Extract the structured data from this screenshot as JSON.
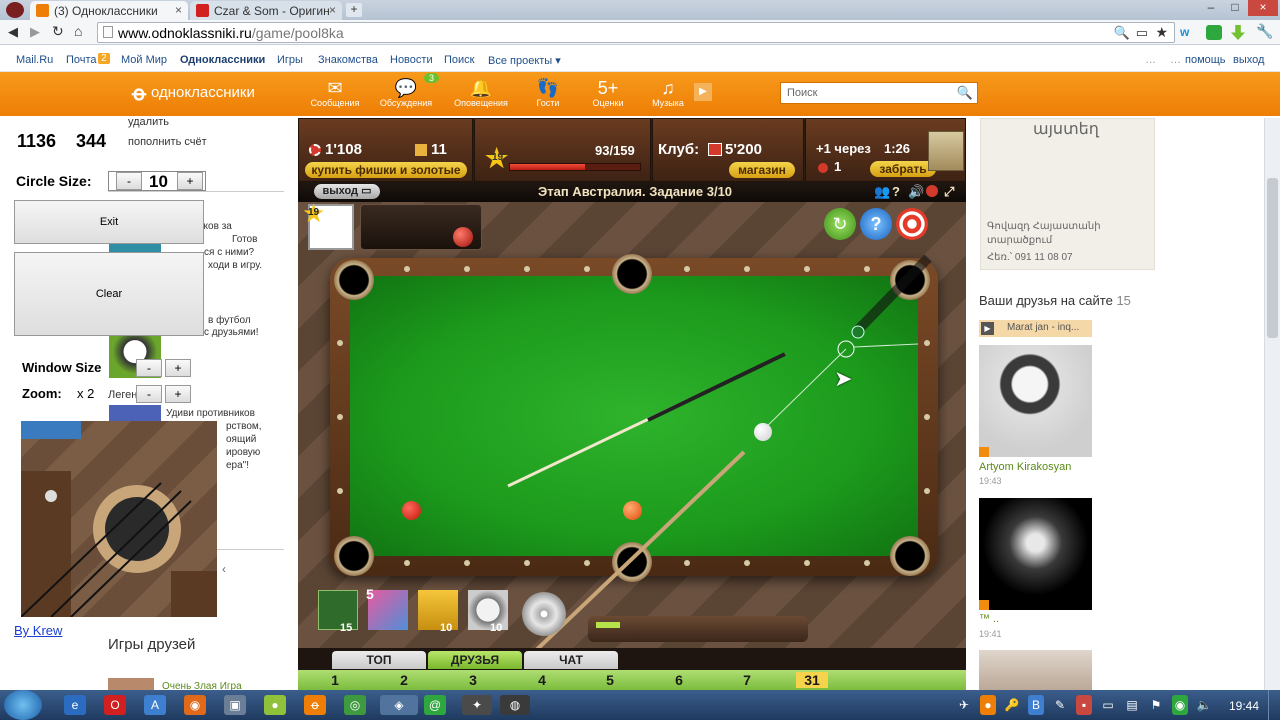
{
  "browser": {
    "tabs": [
      {
        "label": "(3) Одноклассники",
        "active": true
      },
      {
        "label": "Czar & Som - Оригин",
        "active": false
      }
    ],
    "url_domain": "www.odnoklassniki.ru",
    "url_path": "/game/pool8ka"
  },
  "mailbar": {
    "links": [
      "Mail.Ru",
      "Почта",
      "Мой Мир",
      "Одноклассники",
      "Игры",
      "Знакомства",
      "Новости",
      "Поиск",
      "Все проекты ▾"
    ],
    "mail_badge": "2",
    "right_dots": "…",
    "help": "помощь",
    "logout": "выход"
  },
  "ok": {
    "logo": "одноклассники",
    "nav": [
      "Сообщения",
      "Обсуждения",
      "Оповещения",
      "Гости",
      "Оценки",
      "Музыка"
    ],
    "discussions_badge": "3",
    "search_placeholder": "Поиск"
  },
  "tool": {
    "coord_x": "1136",
    "coord_y": "344",
    "circle_size_label": "Circle Size:",
    "circle_size_value": "10",
    "exit_label": "Exit",
    "clear_label": "Clear",
    "window_size_label": "Window Size",
    "zoom_label": "Zoom:",
    "zoom_value": "x 2",
    "minus": "-",
    "plus": "+",
    "credit": "By Krew"
  },
  "left_column": {
    "delete": "удалить",
    "topup": "пополнить счёт",
    "fragments": [
      "рков за",
      "Готов",
      "ся с ними?",
      "ходи в игру.",
      "в футбол",
      "с друзьями!",
      "Удиви противников",
      "рством,",
      "оящий",
      "ировую",
      "ера\"!"
    ],
    "friends_games": "Игры друзей",
    "game_link": "Очень Злая Игра",
    "legend_fragment": "Леген"
  },
  "game": {
    "chips": "1'108",
    "gold": "11",
    "buy_button": "купить фишки и золотые",
    "level": "19",
    "xp": "93/159",
    "xp_fraction": 0.58,
    "club_label": "Клуб:",
    "club_value": "5'200",
    "shop_button": "магазин",
    "bonus_text": "+1 через",
    "bonus_time": "1:26",
    "bonus_count": "1",
    "take_button": "забрать",
    "exit_button": "выход",
    "stage_title": "Этап Австралия. Задание 3/10",
    "player_level": "19",
    "powerups": [
      {
        "name": "aim-powerup",
        "count": "15"
      },
      {
        "name": "box-powerup",
        "count": "5"
      },
      {
        "name": "ruler-powerup",
        "count": "10"
      },
      {
        "name": "timer-powerup",
        "count": "10"
      }
    ],
    "tabs": [
      "ТОП",
      "ДРУЗЬЯ",
      "ЧАТ"
    ],
    "active_tab": "ДРУЗЬЯ",
    "ranks": [
      "1",
      "2",
      "3",
      "4",
      "5",
      "6",
      "7",
      "31"
    ]
  },
  "right_sidebar": {
    "ad_title": "այստեղ",
    "ad_text1": "Գովազդ Հայաստանի",
    "ad_text2": "տարածքում",
    "ad_phone": "Հեռ.՝ 091 11 08 07",
    "friends_header": "Ваши друзья на сайте",
    "friends_count": "15",
    "now_playing": "Marat jan - inq...",
    "friend1_name": "Artyom Kirakosyan",
    "friend1_time": "19:43",
    "friend2_name": "™ ..",
    "friend2_time": "19:41"
  },
  "taskbar": {
    "time": "19:44"
  },
  "colors": {
    "ok_orange": "#ee7e05",
    "cloth_green": "#1c9a1c",
    "link_blue": "#1f4f8b"
  }
}
